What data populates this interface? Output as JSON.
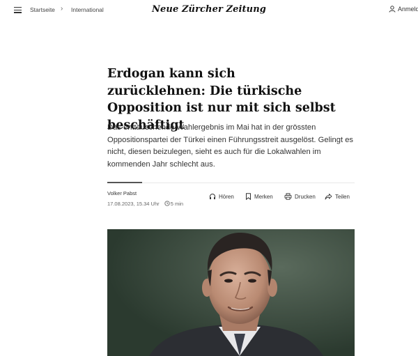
{
  "header": {
    "breadcrumb": [
      "Startseite",
      "International"
    ],
    "logo": "Neue Zürcher Zeitung",
    "login_label": "Anmeldem"
  },
  "article": {
    "headline": "Erdogan kann sich zurücklehnen: Die türkische Opposition ist nur mit sich selbst beschäftigt",
    "lead": "Das enttäuschende Wahlergebnis im Mai hat in der grössten Oppositionspartei der Türkei einen Führungsstreit ausgelöst. Gelingt es nicht, diesen beizulegen, sieht es auch für die Lokalwahlen im kommenden Jahr schlecht aus.",
    "author": "Volker Pabst",
    "date": "17.08.2023, 15.34 Uhr",
    "reading_time": "5 min",
    "actions": {
      "listen": "Hören",
      "bookmark": "Merken",
      "print": "Drucken",
      "share": "Teilen"
    }
  },
  "icons": [
    "menu-icon",
    "user-icon",
    "clock-icon",
    "headphones-icon",
    "bookmark-icon",
    "printer-icon",
    "share-icon"
  ]
}
